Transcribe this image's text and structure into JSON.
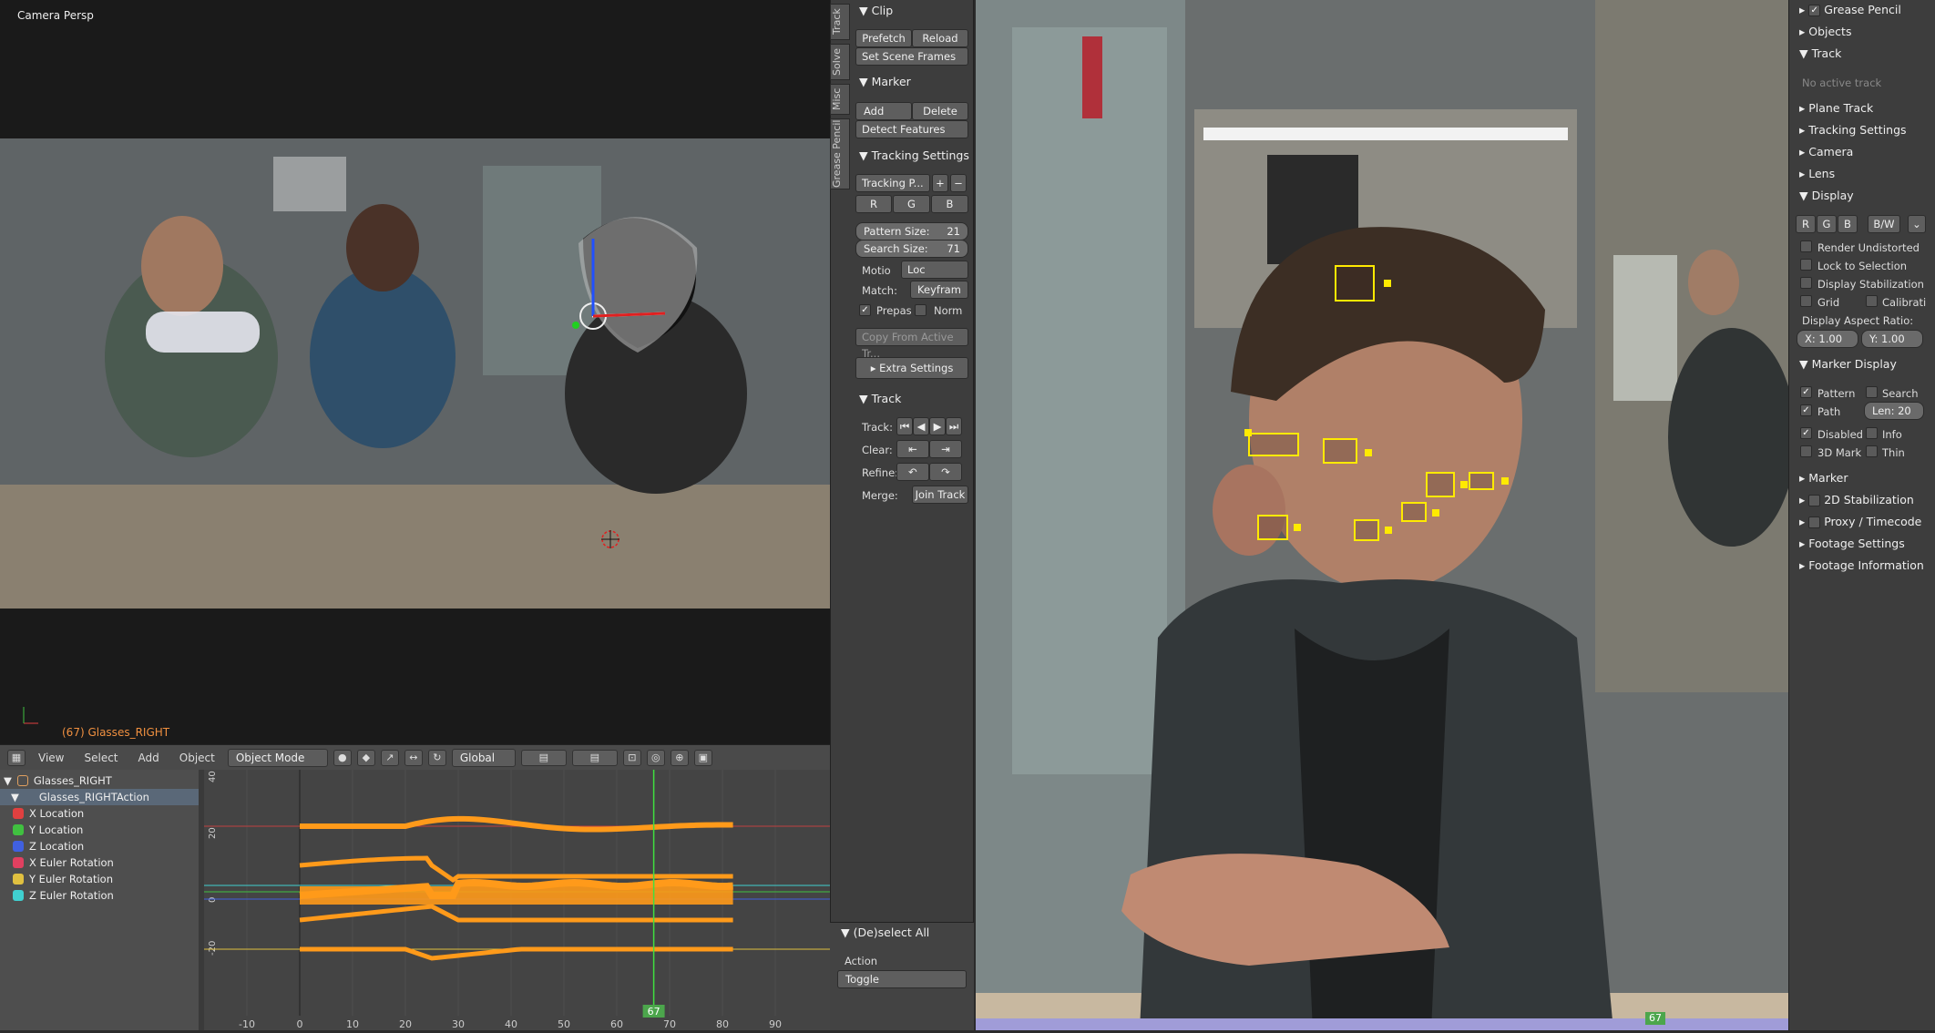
{
  "viewport3d": {
    "label": "Camera Persp",
    "object_label": "(67) Glasses_RIGHT"
  },
  "header": {
    "menus": [
      "View",
      "Select",
      "Add",
      "Object"
    ],
    "mode": "Object Mode",
    "orientation": "Global"
  },
  "graph": {
    "channels": [
      {
        "name": "Glasses_RIGHT",
        "color": "#e0a060"
      },
      {
        "name": "Glasses_RIGHTAction",
        "color": "#80a0c0"
      },
      {
        "name": "X Location",
        "color": "#e04040"
      },
      {
        "name": "Y Location",
        "color": "#40c040"
      },
      {
        "name": "Z Location",
        "color": "#4060e0"
      },
      {
        "name": "X Euler Rotation",
        "color": "#e04060"
      },
      {
        "name": "Y Euler Rotation",
        "color": "#e0c040"
      },
      {
        "name": "Z Euler Rotation",
        "color": "#40d0d0"
      }
    ],
    "x_ticks": [
      "-10",
      "0",
      "10",
      "20",
      "30",
      "40",
      "50",
      "60",
      "70",
      "80",
      "90"
    ],
    "y_ticks": [
      "40",
      "20",
      "0",
      "-20"
    ],
    "current_frame": "67"
  },
  "tools": {
    "tabs": [
      "Track",
      "Solve",
      "Misc",
      "Grease Pencil"
    ],
    "clip": {
      "title": "Clip",
      "prefetch": "Prefetch",
      "reload": "Reload",
      "set_scene_frames": "Set Scene Frames"
    },
    "marker": {
      "title": "Marker",
      "add": "Add",
      "delete": "Delete",
      "detect": "Detect Features"
    },
    "tracking_settings": {
      "title": "Tracking Settings",
      "preset": "Tracking P...",
      "r": "R",
      "g": "G",
      "b": "B",
      "pattern_size": "Pattern Size:",
      "pattern_value": "21",
      "search_size": "Search Size:",
      "search_value": "71",
      "motion_label": "Motio",
      "motion_value": "Loc",
      "match_label": "Match:",
      "match_value": "Keyfram",
      "prepass": "Prepas",
      "normalize": "Norm",
      "copy": "Copy From Active Tr...",
      "extra": "Extra Settings"
    },
    "track": {
      "title": "Track",
      "track_label": "Track:",
      "clear_label": "Clear:",
      "refine_label": "Refine:",
      "merge_label": "Merge:",
      "join": "Join Track"
    },
    "deselect": {
      "title": "(De)select All",
      "action_label": "Action",
      "action_value": "Toggle"
    }
  },
  "clip": {
    "current_frame": "67"
  },
  "props": {
    "grease_pencil": "Grease Pencil",
    "objects": "Objects",
    "track": "Track",
    "no_active": "No active track",
    "plane_track": "Plane Track",
    "tracking_settings": "Tracking Settings",
    "camera": "Camera",
    "lens": "Lens",
    "display": "Display",
    "display_channels": [
      "R",
      "G",
      "B",
      "B/W"
    ],
    "render_undistorted": "Render Undistorted",
    "lock_selection": "Lock to Selection",
    "display_stabilization": "Display Stabilization",
    "grid": "Grid",
    "calibration": "Calibrati",
    "aspect_ratio": "Display Aspect Ratio:",
    "aspect_x": "X: 1.00",
    "aspect_y": "Y: 1.00",
    "marker_display": "Marker Display",
    "pattern": "Pattern",
    "search": "Search",
    "path": "Path",
    "path_len": "Len: 20",
    "disabled": "Disabled",
    "info": "Info",
    "mark3d": "3D Mark",
    "thin": "Thin",
    "marker": "Marker",
    "stabilization": "2D Stabilization",
    "proxy": "Proxy / Timecode",
    "footage_settings": "Footage Settings",
    "footage_info": "Footage Information"
  }
}
